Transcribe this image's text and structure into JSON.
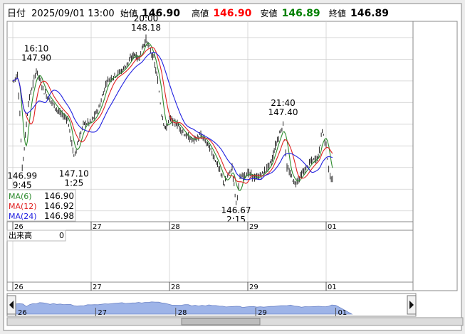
{
  "header": {
    "label_date": "日付",
    "datetime": "2025/09/01 13:00",
    "label_open": "始値",
    "open": "146.90",
    "label_high": "高値",
    "high": "146.90",
    "label_low": "安値",
    "low": "146.89",
    "label_close": "終値",
    "close": "146.89"
  },
  "colors": {
    "high": "#ff0000",
    "low": "#008000",
    "ma6": "#2e8b2e",
    "ma12": "#e02020",
    "ma24": "#2020e0",
    "volume_fill": "#9eb4e8"
  },
  "legend": [
    {
      "label": "MA(6)",
      "value": "146.90"
    },
    {
      "label": "MA(12)",
      "value": "146.92"
    },
    {
      "label": "MA(24)",
      "value": "146.98"
    }
  ],
  "volume": {
    "label": "出来高",
    "value": "0"
  },
  "annotations": [
    {
      "time": "20:00",
      "price": "148.18"
    },
    {
      "time": "16:10",
      "price": "147.90"
    },
    {
      "time": "21:40",
      "price": "147.40"
    },
    {
      "time": "1:25",
      "price": "147.10"
    },
    {
      "time": "9:45",
      "price": "146.99"
    },
    {
      "time": "2:15",
      "price": "146.67"
    }
  ],
  "chart_data": {
    "type": "line",
    "title": "",
    "y_ticks": [
      "148.2",
      "148.0",
      "147.8",
      "147.6",
      "147.4",
      "147.2",
      "147.0",
      "146.8",
      "146.6"
    ],
    "ylim": [
      146.5,
      148.35
    ],
    "x_ticks": [
      "26",
      "27",
      "28",
      "29",
      "01"
    ],
    "x_tick_pos": [
      0,
      1,
      2,
      3,
      4
    ],
    "xlim": [
      0,
      4.2
    ],
    "grid": true,
    "price_keypoints": [
      [
        0.0,
        147.8
      ],
      [
        0.03,
        147.82
      ],
      [
        0.06,
        147.86
      ],
      [
        0.09,
        147.5
      ],
      [
        0.12,
        146.99
      ],
      [
        0.2,
        147.6
      ],
      [
        0.3,
        147.9
      ],
      [
        0.4,
        147.7
      ],
      [
        0.5,
        147.6
      ],
      [
        0.6,
        147.5
      ],
      [
        0.7,
        147.45
      ],
      [
        0.78,
        147.1
      ],
      [
        0.9,
        147.4
      ],
      [
        1.0,
        147.42
      ],
      [
        1.1,
        147.55
      ],
      [
        1.2,
        147.8
      ],
      [
        1.3,
        147.85
      ],
      [
        1.4,
        147.9
      ],
      [
        1.5,
        148.0
      ],
      [
        1.55,
        148.05
      ],
      [
        1.6,
        148.0
      ],
      [
        1.65,
        148.1
      ],
      [
        1.7,
        148.18
      ],
      [
        1.8,
        148.0
      ],
      [
        1.85,
        147.8
      ],
      [
        1.9,
        147.5
      ],
      [
        1.95,
        147.35
      ],
      [
        2.0,
        147.45
      ],
      [
        2.1,
        147.4
      ],
      [
        2.2,
        147.3
      ],
      [
        2.3,
        147.25
      ],
      [
        2.4,
        147.3
      ],
      [
        2.5,
        147.2
      ],
      [
        2.6,
        147.05
      ],
      [
        2.7,
        146.85
      ],
      [
        2.8,
        147.0
      ],
      [
        2.85,
        146.67
      ],
      [
        2.9,
        146.9
      ],
      [
        3.0,
        146.95
      ],
      [
        3.1,
        146.9
      ],
      [
        3.2,
        146.95
      ],
      [
        3.3,
        147.05
      ],
      [
        3.35,
        147.2
      ],
      [
        3.45,
        147.4
      ],
      [
        3.5,
        147.0
      ],
      [
        3.6,
        146.85
      ],
      [
        3.7,
        146.95
      ],
      [
        3.8,
        147.05
      ],
      [
        3.9,
        147.1
      ],
      [
        3.95,
        147.35
      ],
      [
        4.0,
        147.2
      ],
      [
        4.05,
        146.9
      ],
      [
        4.08,
        146.89
      ]
    ],
    "annotation_x": [
      1.7,
      0.3,
      3.45,
      0.78,
      0.12,
      2.85
    ],
    "annotation_y": [
      148.18,
      147.9,
      147.4,
      147.1,
      146.99,
      146.67
    ],
    "volume_values": [
      0
    ]
  }
}
